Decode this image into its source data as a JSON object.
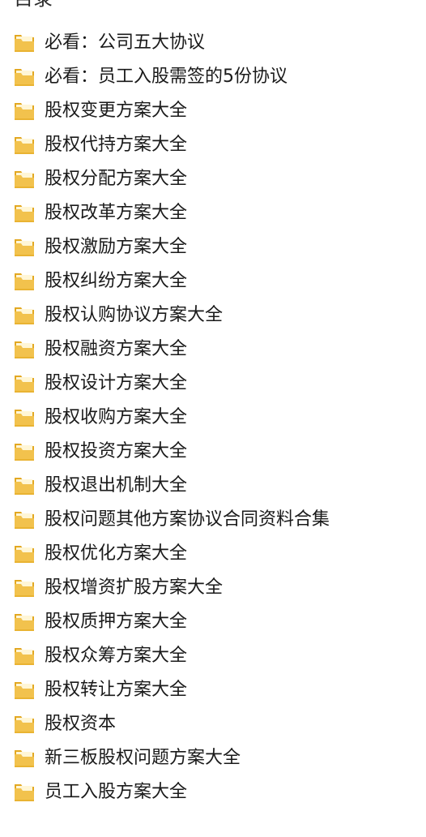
{
  "header": {
    "title_fragment": "目录"
  },
  "colors": {
    "folder_front": "#f2c24d",
    "folder_back": "#e3a822",
    "folder_paper": "#fff6d6",
    "text": "#1a1a1a"
  },
  "folders": [
    {
      "name": "必看：公司五大协议",
      "icon": "folder-icon"
    },
    {
      "name": "必看：员工入股需签的5份协议",
      "icon": "folder-icon"
    },
    {
      "name": "股权变更方案大全",
      "icon": "folder-icon"
    },
    {
      "name": "股权代持方案大全",
      "icon": "folder-icon"
    },
    {
      "name": "股权分配方案大全",
      "icon": "folder-icon"
    },
    {
      "name": "股权改革方案大全",
      "icon": "folder-icon"
    },
    {
      "name": "股权激励方案大全",
      "icon": "folder-icon"
    },
    {
      "name": "股权纠纷方案大全",
      "icon": "folder-icon"
    },
    {
      "name": "股权认购协议方案大全",
      "icon": "folder-icon"
    },
    {
      "name": "股权融资方案大全",
      "icon": "folder-icon"
    },
    {
      "name": "股权设计方案大全",
      "icon": "folder-icon"
    },
    {
      "name": "股权收购方案大全",
      "icon": "folder-icon"
    },
    {
      "name": "股权投资方案大全",
      "icon": "folder-icon"
    },
    {
      "name": "股权退出机制大全",
      "icon": "folder-icon"
    },
    {
      "name": "股权问题其他方案协议合同资料合集",
      "icon": "folder-icon"
    },
    {
      "name": "股权优化方案大全",
      "icon": "folder-icon"
    },
    {
      "name": "股权增资扩股方案大全",
      "icon": "folder-icon"
    },
    {
      "name": "股权质押方案大全",
      "icon": "folder-icon"
    },
    {
      "name": "股权众筹方案大全",
      "icon": "folder-icon"
    },
    {
      "name": "股权转让方案大全",
      "icon": "folder-icon"
    },
    {
      "name": "股权资本",
      "icon": "folder-icon"
    },
    {
      "name": "新三板股权问题方案大全",
      "icon": "folder-icon"
    },
    {
      "name": "员工入股方案大全",
      "icon": "folder-icon"
    }
  ]
}
